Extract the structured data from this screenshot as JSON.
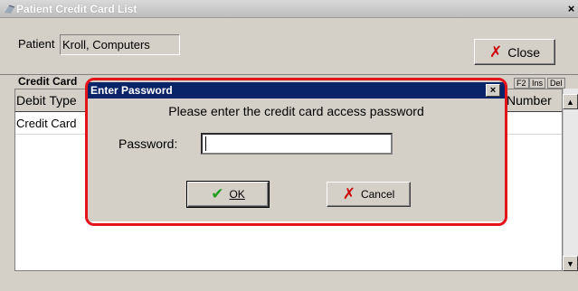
{
  "window": {
    "title": "Patient Credit Card List",
    "close_glyph": "×"
  },
  "patient": {
    "label": "Patient",
    "value": "Kroll, Computers"
  },
  "close_button": {
    "label": "Close",
    "icon": "x-icon"
  },
  "list": {
    "title": "Credit Card",
    "key_tags": [
      "F2",
      "Ins",
      "Del"
    ],
    "columns": [
      "Debit Type",
      "Number"
    ],
    "rows": [
      [
        "Credit Card",
        ""
      ]
    ]
  },
  "dialog": {
    "title": "Enter Password",
    "close_glyph": "×",
    "message": "Please enter the credit card access password",
    "password_label": "Password:",
    "password_value": "",
    "ok_label": "OK",
    "cancel_label": "Cancel"
  },
  "colors": {
    "dialog_titlebar": "#0a246a",
    "highlight_outline": "#e4141b",
    "ok_check": "#1e9e1e",
    "cancel_x": "#cc0000"
  }
}
